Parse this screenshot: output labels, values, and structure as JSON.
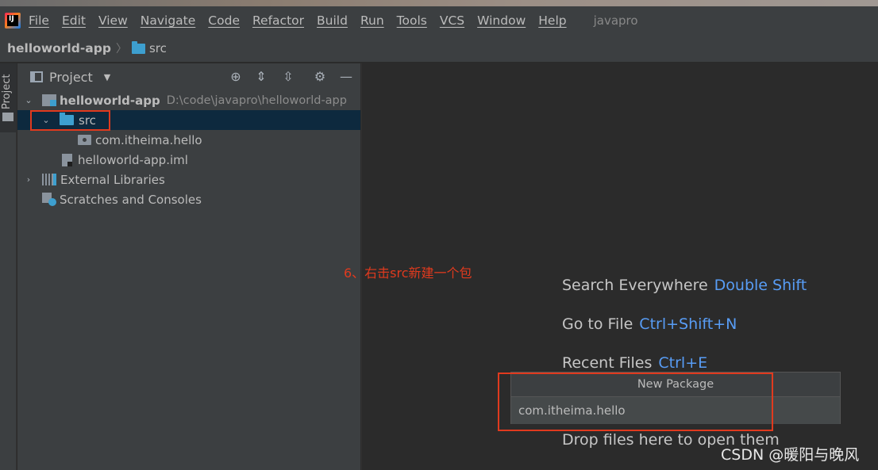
{
  "menubar": {
    "logo_text": "IJ",
    "items": [
      "File",
      "Edit",
      "View",
      "Navigate",
      "Code",
      "Refactor",
      "Build",
      "Run",
      "Tools",
      "VCS",
      "Window",
      "Help"
    ],
    "project_name": "javapro"
  },
  "breadcrumb": {
    "module": "helloworld-app",
    "folder": "src"
  },
  "tool_stripe": {
    "project_tab": "Project"
  },
  "project_panel": {
    "title": "Project",
    "tree": {
      "module_name": "helloworld-app",
      "module_path": "D:\\code\\javapro\\helloworld-app",
      "src": "src",
      "package": "com.itheima.hello",
      "iml": "helloworld-app.iml",
      "external_libraries": "External Libraries",
      "scratches": "Scratches and Consoles"
    }
  },
  "annotation": "6、右击src新建一个包",
  "editor_hints": {
    "search_label": "Search Everywhere",
    "search_key": "Double Shift",
    "goto_label": "Go to File",
    "goto_key": "Ctrl+Shift+N",
    "recent_label": "Recent Files",
    "recent_key": "Ctrl+E",
    "drop_label": "Drop files here to open them"
  },
  "new_package_dialog": {
    "title": "New Package",
    "value": "com.itheima.hello"
  },
  "watermark": "CSDN @暖阳与晚风",
  "colors": {
    "accent_blue": "#589df6",
    "annotation_red": "#e03a1e",
    "selection": "#0d293e"
  }
}
